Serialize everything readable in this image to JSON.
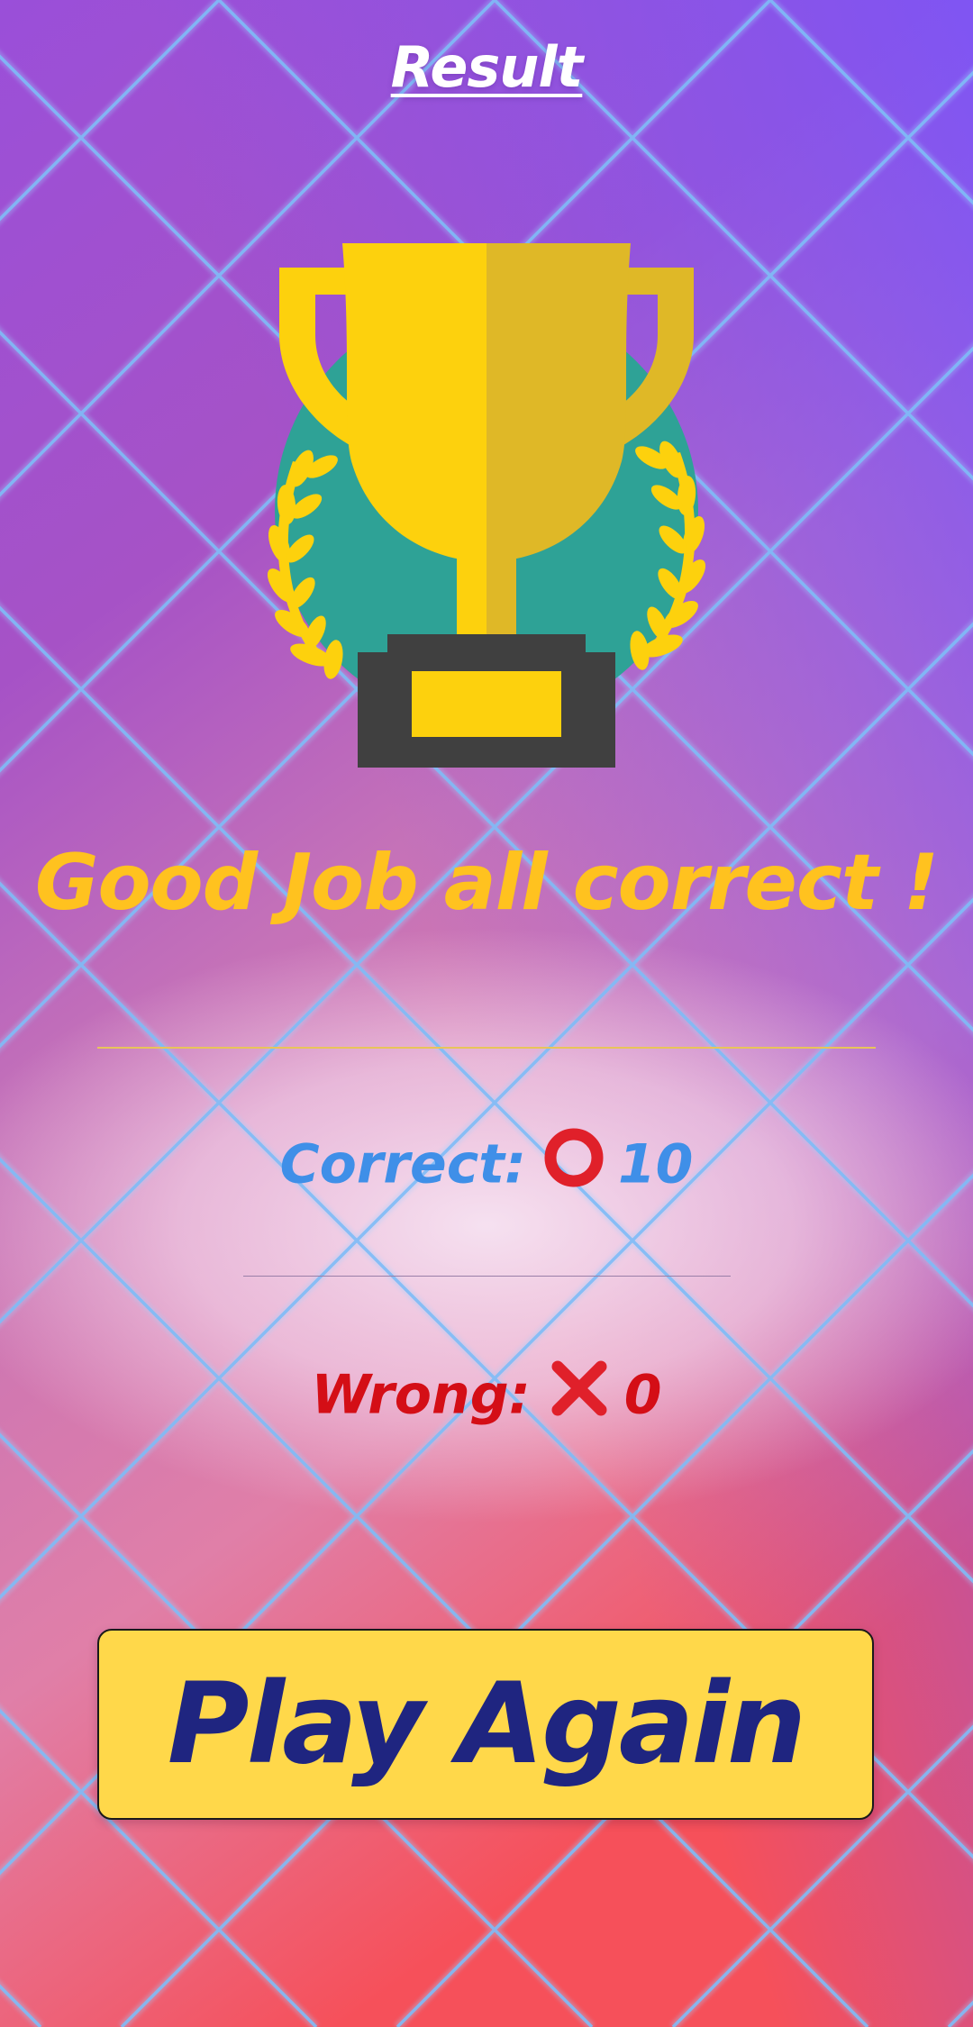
{
  "screen": {
    "title": "Result",
    "headline": "Good Job all correct !",
    "correct": {
      "label": "Correct:",
      "icon": "red-circle-icon",
      "value": "10"
    },
    "wrong": {
      "label": "Wrong:",
      "icon": "red-cross-icon",
      "value": "0"
    },
    "play_again_label": "Play Again"
  },
  "colors": {
    "bg_top_left": "#9b4fd8",
    "bg_top_right": "#7d55f5",
    "bg_bottom": "#f5505a",
    "lattice": "#7ab8f5",
    "headline": "#ffc21f",
    "correct_text": "#3f8fe8",
    "wrong_text": "#d40e16",
    "mark_red": "#e0202a",
    "button_bg": "#ffd84a",
    "button_text": "#1f2580",
    "trophy_gold": "#fdd10d",
    "trophy_gold_shade": "#dfb827",
    "trophy_teal": "#2ea296",
    "trophy_base": "#404040"
  }
}
